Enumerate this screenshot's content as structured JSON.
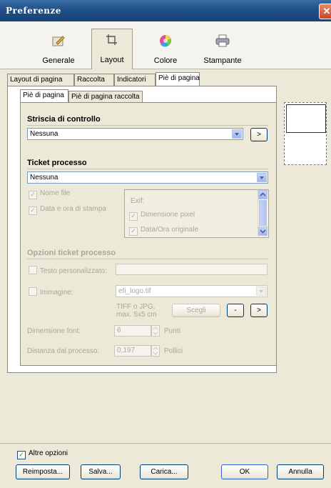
{
  "window": {
    "title": "Preferenze"
  },
  "toolbar": [
    {
      "label": "Generale",
      "icon": "pencil-icon"
    },
    {
      "label": "Layout",
      "icon": "crop-icon"
    },
    {
      "label": "Colore",
      "icon": "color-wheel-icon"
    },
    {
      "label": "Stampante",
      "icon": "printer-icon"
    }
  ],
  "tabs": [
    "Layout di pagina",
    "Raccolta",
    "Indicatori",
    "Piè di pagina"
  ],
  "subtabs": [
    "Piè di pagina",
    "Piè di pagina raccolta"
  ],
  "control_strip": {
    "heading": "Striscia di controllo",
    "value": "Nessuna",
    "more": ">"
  },
  "ticket": {
    "heading": "Ticket processo",
    "value": "Nessuna",
    "file_name": "Nome file",
    "print_datetime": "Data e ora di stampa",
    "exif_header": "Exif:",
    "exif_items": [
      "Dimensione pixel",
      "Data/Ora originale"
    ]
  },
  "ticket_options": {
    "heading": "Opzioni ticket processo",
    "custom_text": "Testo personalizzato:",
    "image": "Immagine:",
    "image_file": "efi_logo.tif",
    "image_hint_1": "TIFF o JPG,",
    "image_hint_2": "max. 5x5 cm",
    "choose": "Scegli",
    "minus": "-",
    "more": ">",
    "font_size_label": "Dimensione font:",
    "font_size_value": "6",
    "font_size_unit": "Punti",
    "distance_label": "Distanza dal processo:",
    "distance_value": "0,197",
    "distance_unit": "Pollici"
  },
  "footer": {
    "more_options": "Altre opzioni",
    "reset": "Reimposta...",
    "save": "Salva...",
    "load": "Carica...",
    "ok": "OK",
    "cancel": "Annulla"
  }
}
